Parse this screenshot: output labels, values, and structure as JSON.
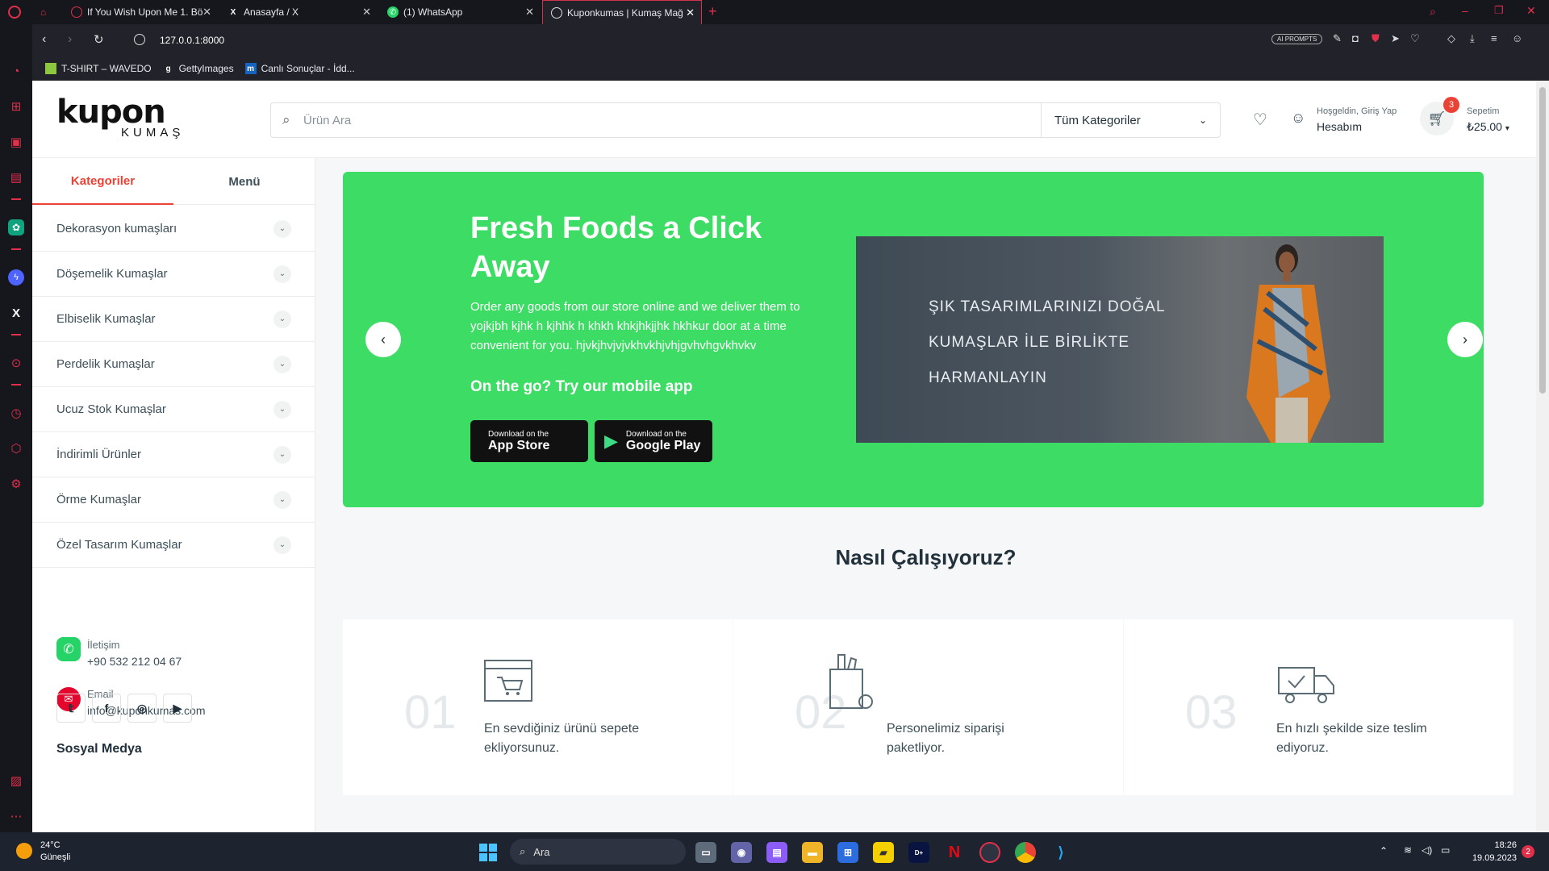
{
  "browser": {
    "tabs": [
      {
        "title": "If You Wish Upon Me 1. Bö",
        "icon": "opera-icon"
      },
      {
        "title": "Anasayfa / X",
        "icon": "x-icon"
      },
      {
        "title": "(1) WhatsApp",
        "icon": "whatsapp-icon"
      },
      {
        "title": "Kuponkumas | Kumaş Mağ",
        "icon": "globe-icon"
      }
    ],
    "new_tab": "+",
    "url": "127.0.0.1:8000",
    "ai_prompts": "AI PROMPTS",
    "bookmarks": [
      {
        "label": "T-SHIRT – WAVEDO",
        "icon": "folder-icon"
      },
      {
        "label": "GettyImages",
        "icon": "g"
      },
      {
        "label": "Canlı Sonuçlar - İdd...",
        "icon": "m"
      }
    ]
  },
  "header": {
    "logo_top": "kupon",
    "logo_bottom": "KUMAŞ",
    "search_placeholder": "Ürün Ara",
    "category_select": "Tüm Kategoriler",
    "account_greeting": "Hoşgeldin, Giriş Yap",
    "account_label": "Hesabım",
    "cart_badge": "3",
    "cart_label": "Sepetim",
    "cart_total": "₺25.00"
  },
  "sidebar": {
    "tab_categories": "Kategoriler",
    "tab_menu": "Menü",
    "categories": [
      "Dekorasyon kumaşları",
      "Döşemelik Kumaşlar",
      "Elbiselik Kumaşlar",
      "Perdelik Kumaşlar",
      "Ucuz Stok Kumaşlar",
      "İndirimli Ürünler",
      "Örme Kumaşlar",
      "Özel Tasarım Kumaşlar"
    ],
    "contact_label": "İletişim",
    "contact_phone": "+90 532 212 04 67",
    "email_label": "Email",
    "email_value": "info@kuponkumas.com",
    "social_title": "Sosyal Medya",
    "social_icons": [
      "twitter-icon",
      "facebook-icon",
      "instagram-icon",
      "youtube-icon"
    ]
  },
  "hero": {
    "title_line1": "Fresh Foods a Click",
    "title_line2": "Away",
    "desc_line1": "Order any goods from our store online and we deliver them to",
    "desc_line2": "yojkjbh kjhk h kjhhk h khkh khkjhkjjhk hkhkur door at a time",
    "desc_line3": "convenient for you. hjvkjhvjvjvkhvkhjvhjgvhvhgvkhvkv",
    "app_cta": "On the go? Try our mobile app",
    "appstore_small": "Download on the",
    "appstore_big": "App Store",
    "googleplay_small": "Download on the",
    "googleplay_big": "Google Play",
    "banner_line1": "ŞIK TASARIMLARINIZI DOĞAL",
    "banner_line2": "KUMAŞLAR İLE BİRLİKTE",
    "banner_line3": "HARMANLAYIN",
    "accent": "#3ddc64"
  },
  "how": {
    "title": "Nasıl Çalışıyoruz?",
    "steps": [
      {
        "num": "01",
        "text": "En sevdiğiniz ürünü sepete ekliyorsunuz."
      },
      {
        "num": "02",
        "text": "Personelimiz siparişi paketliyor."
      },
      {
        "num": "03",
        "text": "En hızlı şekilde size teslim ediyoruz."
      }
    ]
  },
  "taskbar": {
    "weather_temp": "24°C",
    "weather_desc": "Güneşli",
    "search": "Ara",
    "time": "18:26",
    "date": "19.09.2023",
    "notif_count": "2"
  }
}
